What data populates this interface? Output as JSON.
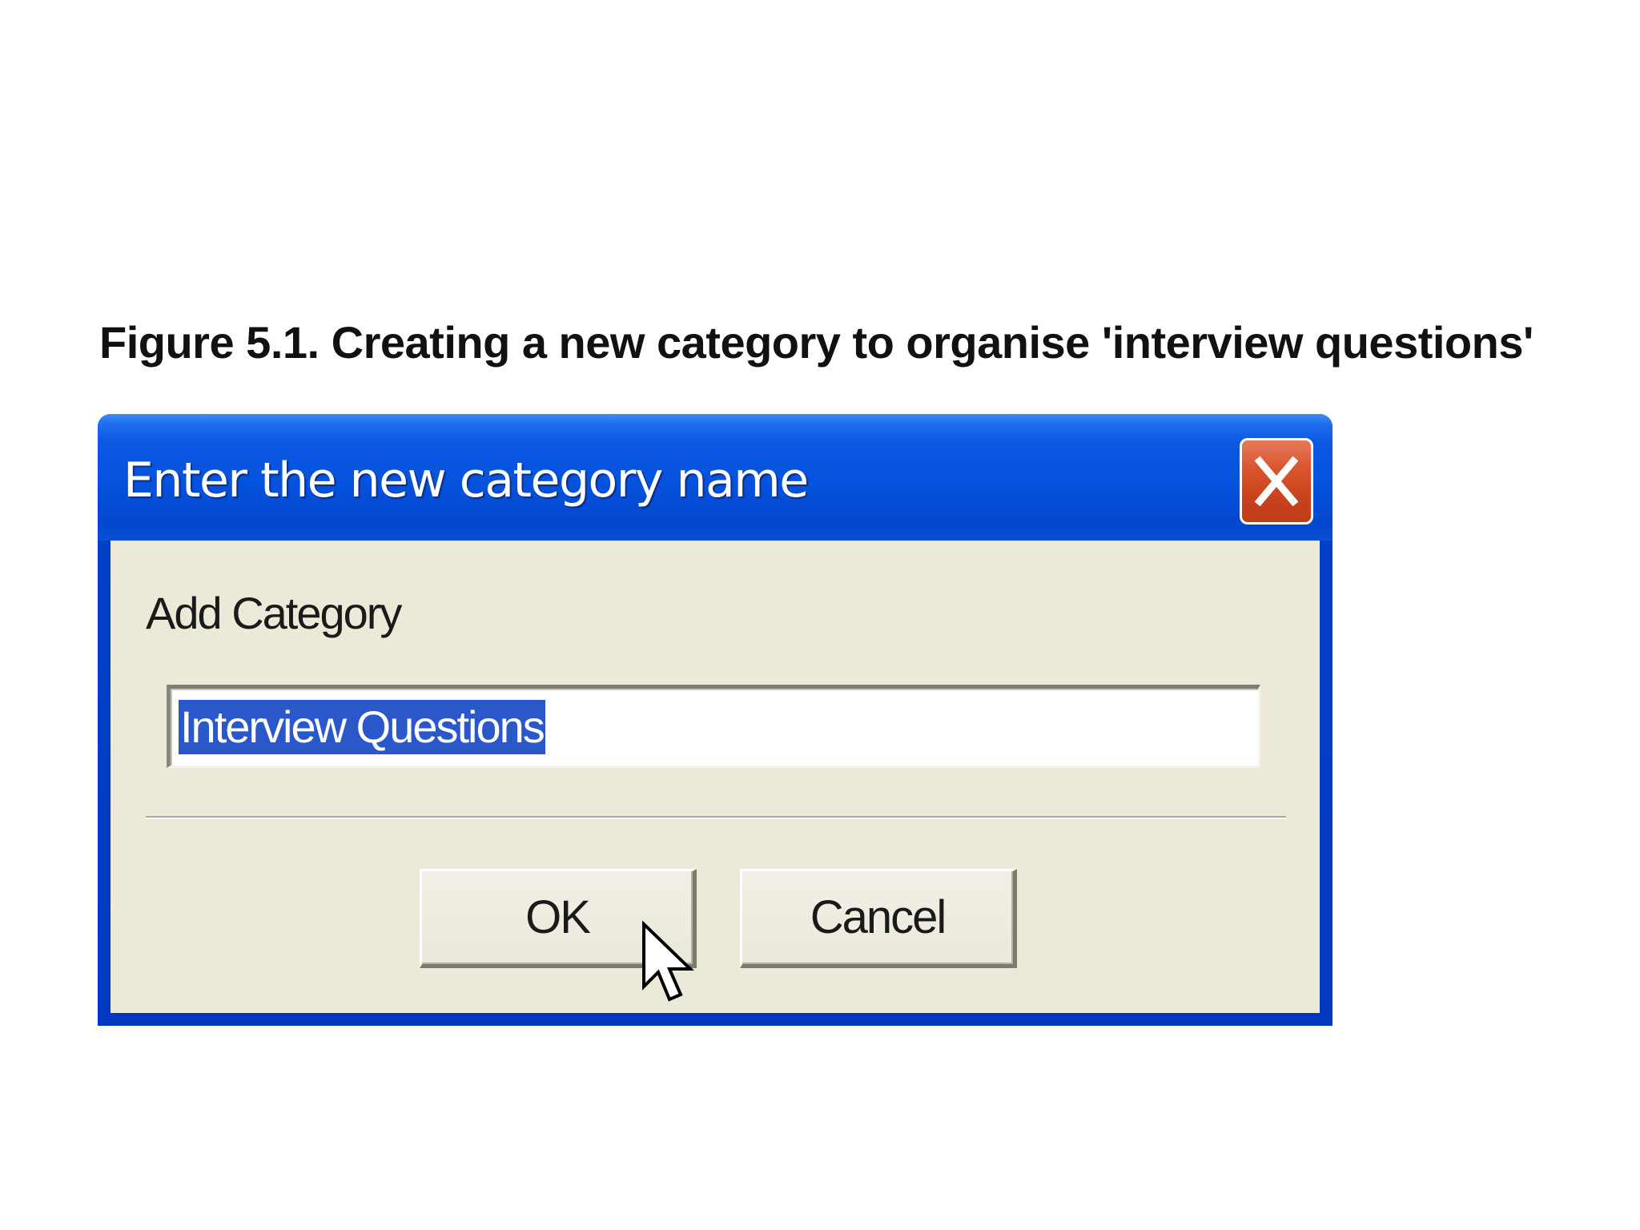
{
  "caption": "Figure 5.1. Creating a new category to organise 'interview questions'",
  "dialog": {
    "title": "Enter the new category name",
    "label": "Add Category",
    "input_value": "Interview Questions",
    "buttons": {
      "ok": "OK",
      "cancel": "Cancel"
    },
    "close_icon": "close-x-icon",
    "cursor_icon": "mouse-pointer-icon"
  },
  "colors": {
    "titlebar": "#0552dc",
    "client_bg": "#ece9d8",
    "close_button": "#d8552e",
    "selection": "#2a57c9"
  }
}
